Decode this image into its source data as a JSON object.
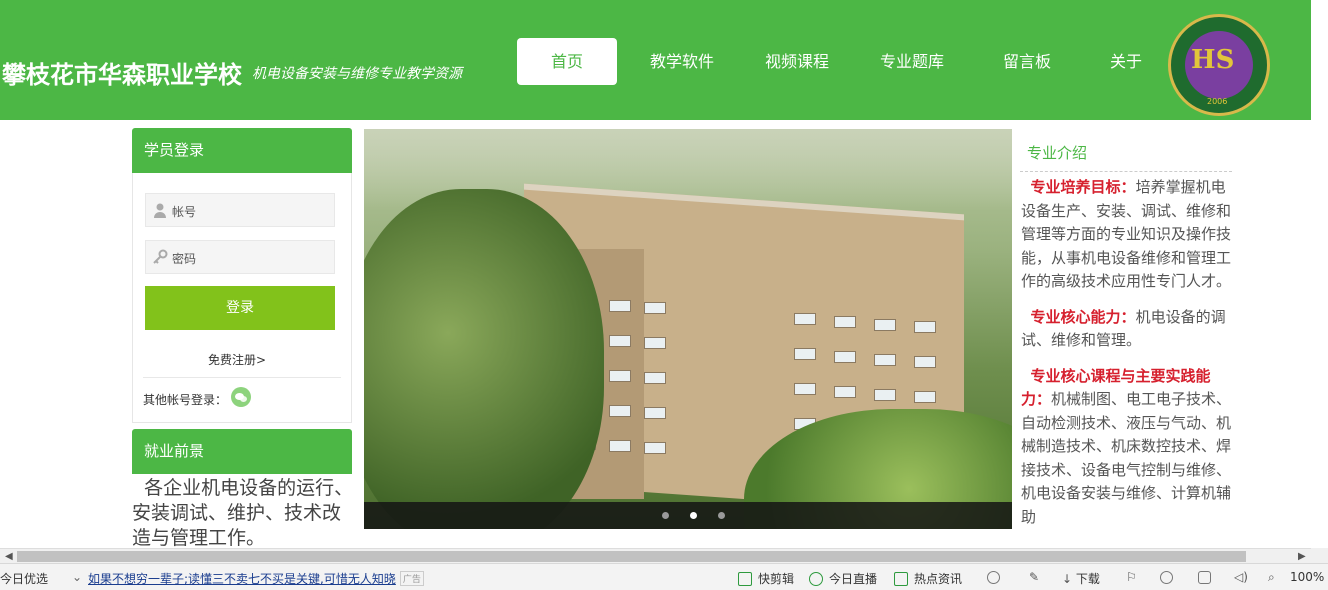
{
  "header": {
    "title": "攀枝花市华森职业学校",
    "subtitle": "机电设备安装与维修专业教学资源",
    "nav": [
      "首页",
      "教学软件",
      "视频课程",
      "专业题库",
      "留言板",
      "关于"
    ],
    "active_nav": "首页",
    "logo_year": "2006"
  },
  "login": {
    "heading": "学员登录",
    "username_placeholder": "帐号",
    "password_placeholder": "密码",
    "submit_label": "登录",
    "register_link": "免费注册>",
    "other_login_label": "其他帐号登录："
  },
  "job": {
    "heading": "就业前景",
    "text": "各企业机电设备的运行、安装调试、维护、技术改造与管理工作。"
  },
  "carousel": {
    "slide_count": 3,
    "active_slide": 2
  },
  "intro": {
    "heading": "专业介绍",
    "sections": [
      {
        "label": "专业培养目标：",
        "text": "培养掌握机电设备生产、安装、调试、维修和管理等方面的专业知识及操作技能，从事机电设备维修和管理工作的高级技术应用性专门人才。"
      },
      {
        "label": "专业核心能力：",
        "text": "机电设备的调试、维修和管理。"
      },
      {
        "label": "专业核心课程与主要实践能力：",
        "text": "机械制图、电工电子技术、自动检测技术、液压与气动、机械制造技术、机床数控技术、焊接技术、设备电气控制与维修、机电设备安装与维修、计算机辅助"
      }
    ]
  },
  "statusbar": {
    "left_label": "今日优选",
    "news": "如果不想穷一辈子;读懂三不卖七不买是关键,可惜无人知晓",
    "ad_tag": "广告",
    "items": [
      "快剪辑",
      "今日直播",
      "热点资讯",
      "下载"
    ],
    "zoom": "100%"
  },
  "colors": {
    "brand_green": "#4cb745",
    "button_green": "#82c21b",
    "highlight_red": "#d6202e"
  }
}
